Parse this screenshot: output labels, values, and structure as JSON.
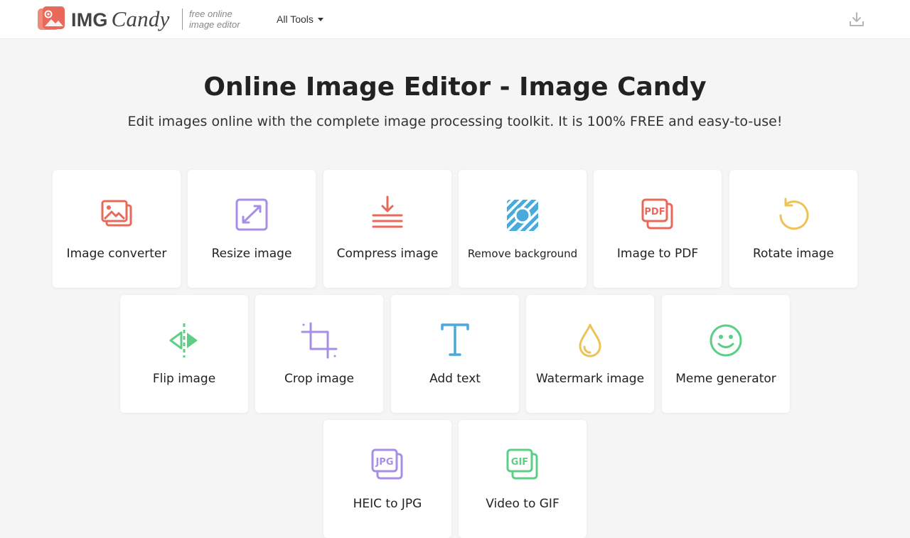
{
  "header": {
    "logo_img": "IMG",
    "logo_candy": "Candy",
    "tagline_line1": "free online",
    "tagline_line2": "image editor",
    "all_tools_label": "All Tools"
  },
  "main": {
    "title": "Online Image Editor - Image Candy",
    "subtitle": "Edit images online with the complete image processing toolkit. It is 100% FREE and easy-to-use!"
  },
  "tools": [
    {
      "label": "Image converter",
      "icon": "image-converter-icon",
      "color": "#e8685a"
    },
    {
      "label": "Resize image",
      "icon": "resize-icon",
      "color": "#a78ee6"
    },
    {
      "label": "Compress image",
      "icon": "compress-icon",
      "color": "#e8685a"
    },
    {
      "label": "Remove background",
      "icon": "remove-background-icon",
      "color": "#4ba9dc"
    },
    {
      "label": "Image to PDF",
      "icon": "pdf-icon",
      "color": "#e8685a"
    },
    {
      "label": "Rotate image",
      "icon": "rotate-icon",
      "color": "#eec255"
    },
    {
      "label": "Flip image",
      "icon": "flip-icon",
      "color": "#5ccf85"
    },
    {
      "label": "Crop image",
      "icon": "crop-icon",
      "color": "#a78ee6"
    },
    {
      "label": "Add text",
      "icon": "text-icon",
      "color": "#4ba9dc"
    },
    {
      "label": "Watermark image",
      "icon": "watermark-drop-icon",
      "color": "#eec255"
    },
    {
      "label": "Meme generator",
      "icon": "smiley-icon",
      "color": "#5ccf85"
    },
    {
      "label": "HEIC to JPG",
      "icon": "jpg-file-icon",
      "color": "#a78ee6"
    },
    {
      "label": "Video to GIF",
      "icon": "gif-file-icon",
      "color": "#5ccf85"
    }
  ],
  "icon_text": {
    "pdf": "PDF",
    "jpg": "JPG",
    "gif": "GIF"
  },
  "colors": {
    "brand": "#e8685a",
    "background": "#f5f5f5"
  }
}
